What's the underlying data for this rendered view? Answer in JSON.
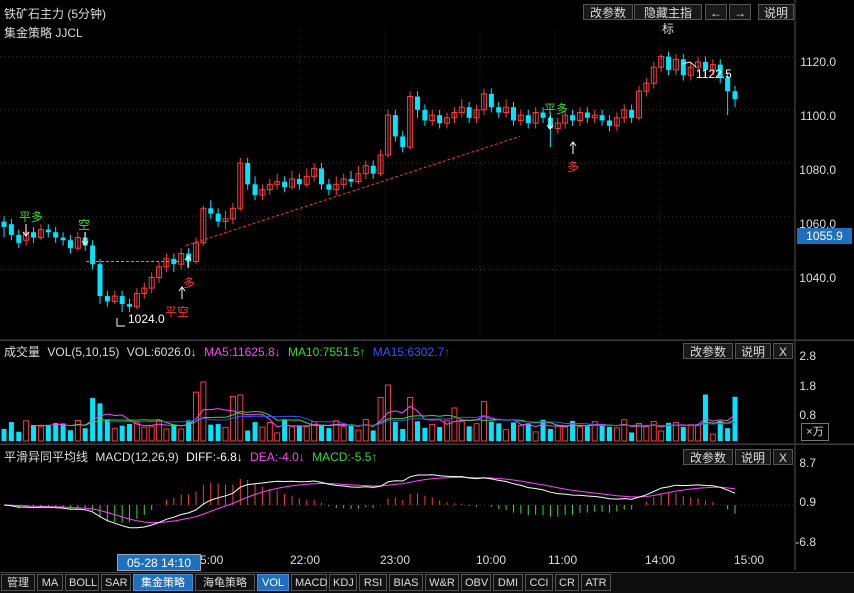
{
  "header": {
    "title": "铁矿石主力 (5分钟)",
    "strategy": "集金策略 JJCL",
    "buttons": {
      "params": "改参数",
      "hide": "隐藏主指标",
      "prev": "←",
      "next": "→",
      "help": "说明"
    }
  },
  "main": {
    "price_labels": [
      "1120.0",
      "1100.0",
      "1080.0",
      "1060.0",
      "1040.0"
    ],
    "current_price": "1055.9",
    "high_label": "1122.5",
    "low_label": "1024.0",
    "signals": [
      "平多",
      "空",
      "多",
      "平空",
      "平多",
      "多"
    ]
  },
  "volume": {
    "label": "成交量",
    "vol_name": "VOL(5,10,15)",
    "vol_val": "VOL:6026.0↓",
    "ma5": "MA5:11625.8↓",
    "ma10": "MA10:7551.5↑",
    "ma15": "MA15:6302.7↑",
    "y_labels": [
      "2.8",
      "1.8",
      "0.8"
    ],
    "unit": "×万",
    "params": "改参数",
    "help": "说明",
    "close": "X"
  },
  "macd": {
    "label": "平滑异同平均线",
    "name": "MACD(12,26,9)",
    "diff": "DIFF:-6.8↓",
    "dea": "DEA:-4.0↓",
    "macd": "MACD:-5.5↑",
    "y_labels": [
      "8.7",
      "0.9",
      "-6.8"
    ],
    "params": "改参数",
    "help": "说明",
    "close": "X"
  },
  "time_axis": {
    "labels": [
      "22:00",
      "23:00",
      "10:00",
      "11:00",
      "14:00",
      "15:00"
    ],
    "partial": "5:00",
    "cursor": "05-28 14:10"
  },
  "tabs": [
    "管理",
    "MA",
    "BOLL",
    "SAR",
    "集金策略",
    "海龟策略",
    "VOL",
    "MACD",
    "KDJ",
    "RSI",
    "BIAS",
    "W&R",
    "OBV",
    "DMI",
    "CCI",
    "CR",
    "ATR"
  ],
  "colors": {
    "up": "#ff3b3b",
    "down": "#00e5ff",
    "ma5": "#ff44ff",
    "ma10": "#33dd33",
    "ma15": "#3355ff",
    "diff": "#ffffff",
    "dea": "#ff44ff",
    "signal_green": "#33dd33",
    "signal_red": "#ff3333"
  },
  "chart_data": {
    "type": "candlestick",
    "ylim": [
      1015,
      1130
    ],
    "candles": [
      [
        1058,
        1056,
        1060,
        1052
      ],
      [
        1057,
        1053,
        1059,
        1051
      ],
      [
        1053,
        1050,
        1055,
        1048
      ],
      [
        1051,
        1054,
        1056,
        1049
      ],
      [
        1054,
        1052,
        1056,
        1050
      ],
      [
        1052,
        1055,
        1057,
        1051
      ],
      [
        1055,
        1054,
        1057,
        1052
      ],
      [
        1054,
        1052,
        1056,
        1050
      ],
      [
        1052,
        1051,
        1054,
        1049
      ],
      [
        1051,
        1048,
        1053,
        1046
      ],
      [
        1048,
        1052,
        1054,
        1047
      ],
      [
        1052,
        1049,
        1054,
        1047
      ],
      [
        1049,
        1042,
        1051,
        1040
      ],
      [
        1042,
        1030,
        1044,
        1027
      ],
      [
        1030,
        1028,
        1032,
        1026
      ],
      [
        1028,
        1030,
        1032,
        1027
      ],
      [
        1030,
        1027,
        1032,
        1024
      ],
      [
        1027,
        1026,
        1029,
        1024
      ],
      [
        1026,
        1031,
        1033,
        1025
      ],
      [
        1031,
        1033,
        1035,
        1029
      ],
      [
        1033,
        1037,
        1039,
        1031
      ],
      [
        1037,
        1041,
        1043,
        1035
      ],
      [
        1041,
        1044,
        1046,
        1039
      ],
      [
        1044,
        1042,
        1046,
        1039
      ],
      [
        1042,
        1046,
        1048,
        1040
      ],
      [
        1046,
        1043,
        1048,
        1041
      ],
      [
        1043,
        1050,
        1052,
        1042
      ],
      [
        1050,
        1063,
        1064,
        1049
      ],
      [
        1063,
        1061,
        1066,
        1059
      ],
      [
        1061,
        1058,
        1063,
        1056
      ],
      [
        1058,
        1059,
        1062,
        1055
      ],
      [
        1059,
        1063,
        1065,
        1057
      ],
      [
        1063,
        1080,
        1082,
        1062
      ],
      [
        1080,
        1072,
        1082,
        1070
      ],
      [
        1072,
        1068,
        1075,
        1066
      ],
      [
        1068,
        1070,
        1072,
        1066
      ],
      [
        1070,
        1072,
        1074,
        1068
      ],
      [
        1072,
        1073,
        1076,
        1070
      ],
      [
        1073,
        1071,
        1075,
        1069
      ],
      [
        1071,
        1074,
        1077,
        1070
      ],
      [
        1074,
        1072,
        1076,
        1070
      ],
      [
        1072,
        1075,
        1078,
        1071
      ],
      [
        1075,
        1078,
        1080,
        1073
      ],
      [
        1078,
        1072,
        1080,
        1070
      ],
      [
        1072,
        1070,
        1074,
        1068
      ],
      [
        1070,
        1072,
        1075,
        1068
      ],
      [
        1072,
        1074,
        1076,
        1070
      ],
      [
        1074,
        1073,
        1077,
        1071
      ],
      [
        1073,
        1076,
        1079,
        1072
      ],
      [
        1076,
        1079,
        1081,
        1074
      ],
      [
        1079,
        1076,
        1081,
        1074
      ],
      [
        1076,
        1083,
        1085,
        1075
      ],
      [
        1083,
        1098,
        1100,
        1082
      ],
      [
        1098,
        1090,
        1100,
        1088
      ],
      [
        1090,
        1086,
        1092,
        1084
      ],
      [
        1086,
        1105,
        1107,
        1085
      ],
      [
        1105,
        1100,
        1107,
        1097
      ],
      [
        1100,
        1096,
        1102,
        1094
      ],
      [
        1096,
        1098,
        1100,
        1094
      ],
      [
        1098,
        1095,
        1100,
        1093
      ],
      [
        1095,
        1097,
        1099,
        1093
      ],
      [
        1097,
        1099,
        1101,
        1095
      ],
      [
        1099,
        1101,
        1104,
        1097
      ],
      [
        1101,
        1097,
        1103,
        1095
      ],
      [
        1097,
        1100,
        1102,
        1095
      ],
      [
        1100,
        1106,
        1108,
        1098
      ],
      [
        1106,
        1101,
        1108,
        1099
      ],
      [
        1101,
        1099,
        1103,
        1097
      ],
      [
        1099,
        1101,
        1104,
        1097
      ],
      [
        1101,
        1096,
        1103,
        1094
      ],
      [
        1096,
        1098,
        1100,
        1094
      ],
      [
        1098,
        1095,
        1100,
        1093
      ],
      [
        1095,
        1099,
        1101,
        1093
      ],
      [
        1099,
        1097,
        1101,
        1095
      ],
      [
        1097,
        1093,
        1099,
        1086
      ],
      [
        1093,
        1095,
        1097,
        1091
      ],
      [
        1095,
        1098,
        1100,
        1093
      ],
      [
        1098,
        1096,
        1100,
        1094
      ],
      [
        1096,
        1099,
        1101,
        1094
      ],
      [
        1099,
        1097,
        1101,
        1095
      ],
      [
        1097,
        1098,
        1100,
        1095
      ],
      [
        1098,
        1096,
        1100,
        1094
      ],
      [
        1096,
        1094,
        1098,
        1092
      ],
      [
        1094,
        1097,
        1099,
        1092
      ],
      [
        1097,
        1100,
        1102,
        1095
      ],
      [
        1100,
        1097,
        1102,
        1095
      ],
      [
        1097,
        1107,
        1109,
        1096
      ],
      [
        1107,
        1110,
        1112,
        1105
      ],
      [
        1110,
        1116,
        1118,
        1108
      ],
      [
        1116,
        1120,
        1121,
        1114
      ],
      [
        1120,
        1115,
        1122,
        1113
      ],
      [
        1115,
        1119,
        1121,
        1113
      ],
      [
        1119,
        1113,
        1121,
        1111
      ],
      [
        1113,
        1116,
        1118,
        1111
      ],
      [
        1116,
        1118,
        1120,
        1114
      ],
      [
        1118,
        1115,
        1120,
        1112
      ],
      [
        1115,
        1117,
        1119,
        1113
      ],
      [
        1117,
        1112,
        1119,
        1110
      ],
      [
        1112,
        1107,
        1114,
        1098
      ],
      [
        1107,
        1104,
        1109,
        1101
      ]
    ]
  }
}
